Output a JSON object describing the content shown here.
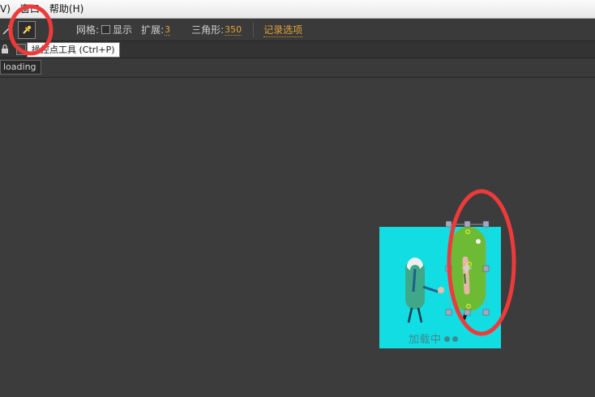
{
  "menu": {
    "items": [
      "V)",
      "窗口",
      "帮助(H)"
    ]
  },
  "toolbar": {
    "grid_label": "网格:",
    "show_label": "显示",
    "expand_label": "扩展:",
    "expand_value": "3",
    "triangle_label": "三角形:",
    "triangle_value": "350",
    "record_link": "记录选项",
    "icons": [
      "pointer-icon",
      "pin-icon"
    ]
  },
  "tooltip": {
    "text": "操控点工具 (Ctrl+P)"
  },
  "layers": {
    "tab_label": "loading"
  },
  "canvas": {
    "loading_text": "加载中",
    "background_color": "#12dde3",
    "accent_color": "#6dbb35"
  },
  "annotations": {
    "color": "#ee3a3a"
  }
}
